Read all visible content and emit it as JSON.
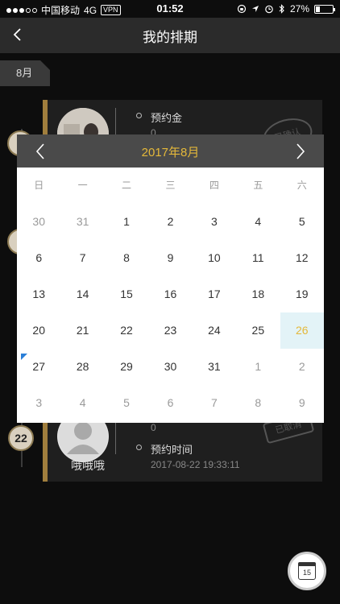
{
  "status": {
    "carrier": "中国移动",
    "network": "4G",
    "vpn": "VPN",
    "time": "01:52",
    "battery": "27%",
    "battery_level": 0.27
  },
  "nav": {
    "title": "我的排期"
  },
  "list": {
    "month_tag": "8月",
    "cards": [
      {
        "label1": "预约金",
        "value1": "0",
        "stamp": "已确认"
      },
      {
        "name": "哦哦哦",
        "value": "0",
        "label2": "预约时间",
        "time": "2017-08-22 19:33:11",
        "stamp": "已取消",
        "day": "22"
      }
    ]
  },
  "calendar": {
    "title": "2017年8月",
    "weekdays": [
      "日",
      "一",
      "二",
      "三",
      "四",
      "五",
      "六"
    ],
    "weeks": [
      [
        {
          "d": "30",
          "m": true
        },
        {
          "d": "31",
          "m": true
        },
        {
          "d": "1"
        },
        {
          "d": "2"
        },
        {
          "d": "3"
        },
        {
          "d": "4"
        },
        {
          "d": "5"
        }
      ],
      [
        {
          "d": "6"
        },
        {
          "d": "7"
        },
        {
          "d": "8"
        },
        {
          "d": "9"
        },
        {
          "d": "10"
        },
        {
          "d": "11"
        },
        {
          "d": "12"
        }
      ],
      [
        {
          "d": "13"
        },
        {
          "d": "14"
        },
        {
          "d": "15"
        },
        {
          "d": "16"
        },
        {
          "d": "17"
        },
        {
          "d": "18"
        },
        {
          "d": "19"
        }
      ],
      [
        {
          "d": "20"
        },
        {
          "d": "21"
        },
        {
          "d": "22"
        },
        {
          "d": "23"
        },
        {
          "d": "24"
        },
        {
          "d": "25"
        },
        {
          "d": "26",
          "sel": true
        }
      ],
      [
        {
          "d": "27",
          "mark": true
        },
        {
          "d": "28"
        },
        {
          "d": "29"
        },
        {
          "d": "30"
        },
        {
          "d": "31"
        },
        {
          "d": "1",
          "m": true
        },
        {
          "d": "2",
          "m": true
        }
      ],
      [
        {
          "d": "3",
          "m": true
        },
        {
          "d": "4",
          "m": true
        },
        {
          "d": "5",
          "m": true
        },
        {
          "d": "6",
          "m": true
        },
        {
          "d": "7",
          "m": true
        },
        {
          "d": "8",
          "m": true
        },
        {
          "d": "9",
          "m": true
        }
      ]
    ],
    "accent_color": "#e4b83a",
    "selected_bg": "#e3f3f7"
  },
  "fab": {
    "icon": "calendar-icon",
    "date": "15"
  }
}
